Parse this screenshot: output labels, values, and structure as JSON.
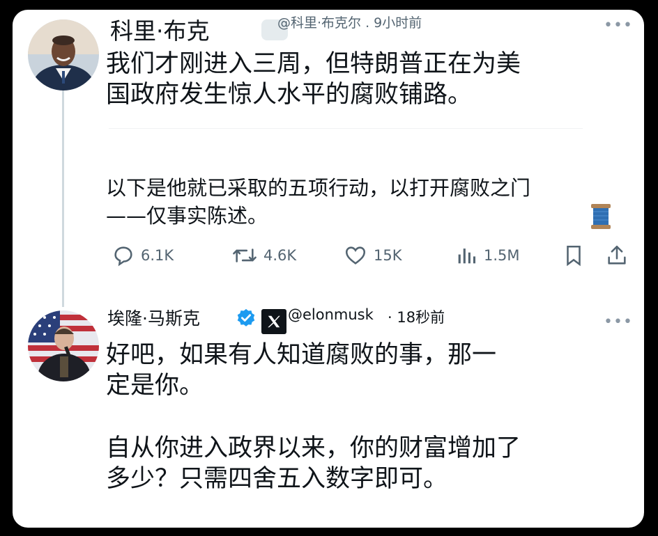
{
  "tweet1": {
    "name": "科里·布克",
    "meta": "@科里·布克尔 . 9小时前",
    "text_lines": [
      "我们才刚进入三周，但特朗普正在为美",
      "国政府发生惊人水平的腐败铺路。"
    ],
    "text2_lines": [
      "以下是他就已采取的五项行动，以打开腐败之门",
      "——仅事实陈述。"
    ],
    "emoji": "spool-of-thread",
    "actions": {
      "replies": "6.1K",
      "retweets": "4.6K",
      "likes": "15K",
      "views": "1.5M"
    }
  },
  "tweet2": {
    "name": "埃隆·马斯克",
    "handle": "@elonmusk",
    "time": "· 18秒前",
    "text_lines": [
      "好吧，如果有人知道腐败的事，那一",
      "定是你。"
    ],
    "text2_lines": [
      "自从你进入政界以来，你的财富增加了",
      "多少？只需四舍五入数字即可。"
    ]
  },
  "icons": {
    "reply": "reply-icon",
    "retweet": "retweet-icon",
    "like": "heart-icon",
    "views": "views-icon",
    "bookmark": "bookmark-icon",
    "share": "share-icon",
    "verified": "verified-badge-icon",
    "x_logo": "x-logo-icon",
    "more": "more-icon"
  },
  "colors": {
    "text": "#0f1419",
    "secondary": "#536471",
    "verified": "#1d9bf0"
  }
}
